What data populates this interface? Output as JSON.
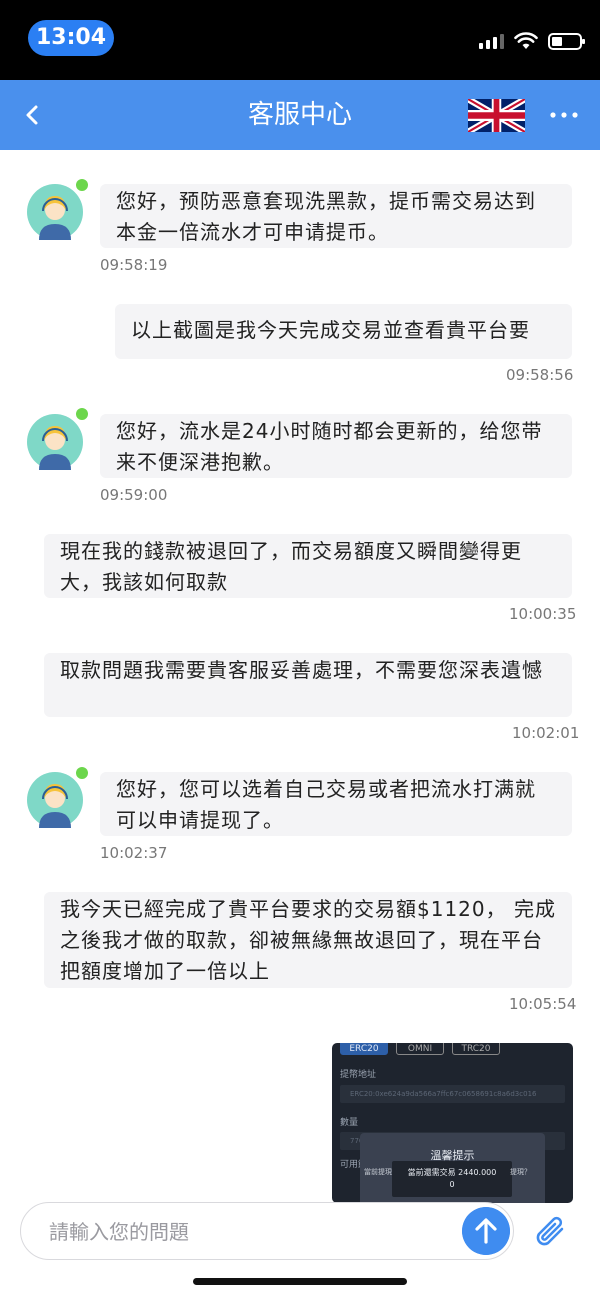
{
  "status_bar": {
    "time": "13:04"
  },
  "header": {
    "title": "客服中心",
    "language_flag": "uk-flag-icon",
    "accent_color": "#4a90ed"
  },
  "messages": [
    {
      "sender": "agent",
      "text": "您好，预防恶意套现洗黑款，提币需交易达到本金一倍流水才可申请提币。",
      "time": "09:58:19"
    },
    {
      "sender": "user",
      "text": "以上截圖是我今天完成交易並查看貴平台要",
      "time": "09:58:56"
    },
    {
      "sender": "agent",
      "text": "您好，流水是24小时随时都会更新的，给您带来不便深港抱歉。",
      "time": "09:59:00"
    },
    {
      "sender": "user",
      "text": "現在我的錢款被退回了，而交易額度又瞬間變得更大，我該如何取款",
      "time": "10:00:35"
    },
    {
      "sender": "user",
      "text": "取款問題我需要貴客服妥善處理，不需要您深表遺憾",
      "time": "10:02:01"
    },
    {
      "sender": "agent",
      "text": "您好，您可以选着自己交易或者把流水打满就可以申请提现了。",
      "time": "10:02:37"
    },
    {
      "sender": "user",
      "text": "我今天已經完成了貴平台要求的交易額$1120， 完成之後我才做的取款，卻被無緣無故退回了，現在平台把額度增加了一倍以上",
      "time": "10:05:54"
    }
  ],
  "image_message": {
    "tabs": [
      "ERC20",
      "OMNI",
      "TRC20"
    ],
    "address_label": "提幣地址",
    "address_value": "ERC20:0xe624a9da566a7ffc67c0658691c8a6d3c016",
    "quantity_label": "數量",
    "quantity_value": "770",
    "available_label": "可用餘",
    "dialog_title": "溫馨提示",
    "dialog_line_1": "當前還需交易  2440.000",
    "dialog_line_1_prefix": "當前提現",
    "dialog_line_1_suffix": "提現？",
    "dialog_line_2": "0"
  },
  "input": {
    "placeholder": "請輸入您的問題"
  }
}
